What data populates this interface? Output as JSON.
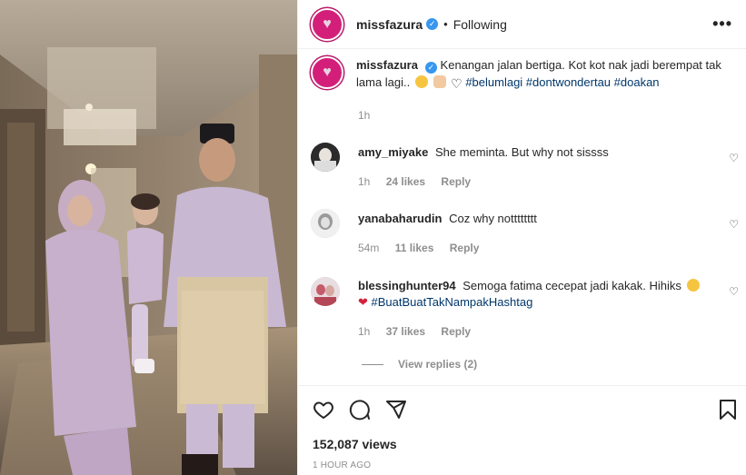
{
  "post": {
    "username": "missfazura",
    "following_label": "Following",
    "more_label": "•••",
    "caption": {
      "username": "missfazura",
      "text": "Kenangan jalan bertiga. Kot kot nak jadi berempat tak lama lagi..",
      "hashtags": "#belumlagi #dontwondertau #doakan",
      "time": "1h"
    }
  },
  "comments": [
    {
      "username": "amy_miyake",
      "text": "She meminta. But why not sissss",
      "time": "1h",
      "likes": "24 likes",
      "reply": "Reply",
      "avatar_color": "#2b2b2b"
    },
    {
      "username": "yanabaharudin",
      "text": "Coz why notttttttt",
      "time": "54m",
      "likes": "11 likes",
      "reply": "Reply",
      "avatar_color": "#9a9a9a"
    },
    {
      "username": "blessinghunter94",
      "text": "Semoga fatima cecepat jadi kakak. Hihiks",
      "hashtag": "#BuatBuatTakNampakHashtag",
      "time": "1h",
      "likes": "37 likes",
      "reply": "Reply",
      "avatar_color": "#d8c3c9",
      "view_replies": "View replies (2)"
    }
  ],
  "footer": {
    "views": "152,087 views",
    "ago": "1 HOUR AGO"
  },
  "icons": {
    "like": "heart-icon",
    "comment": "comment-icon",
    "share": "share-icon",
    "save": "bookmark-icon",
    "verified": "verified-badge-icon"
  },
  "colors": {
    "brand_avatar": "#d31f7a",
    "hashtag": "#00376b",
    "verified": "#3897f0",
    "muted": "#8e8e8e"
  }
}
